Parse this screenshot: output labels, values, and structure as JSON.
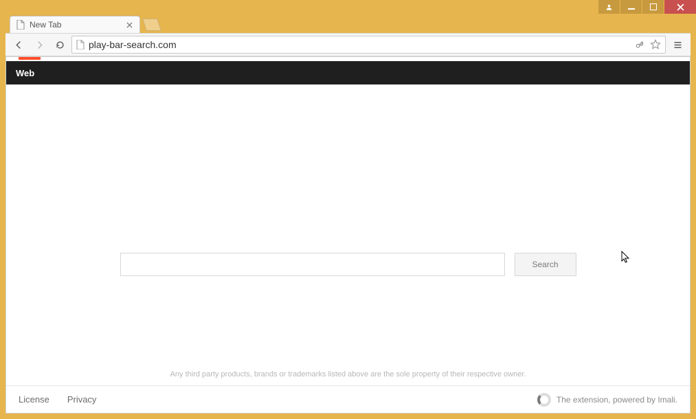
{
  "window": {
    "controls": {
      "user": "user",
      "minimize": "minimize",
      "maximize": "maximize",
      "close": "close"
    }
  },
  "browser": {
    "tab": {
      "title": "New Tab"
    },
    "address_url": "play-bar-search.com"
  },
  "page": {
    "nav": {
      "web_label": "Web"
    },
    "search": {
      "value": "",
      "placeholder": "",
      "button_label": "Search"
    },
    "disclaimer": "Any third party products, brands or trademarks listed above are the sole property of their respective owner.",
    "footer": {
      "license": "License",
      "privacy": "Privacy",
      "powered": "The extension, powered by Imali."
    }
  }
}
